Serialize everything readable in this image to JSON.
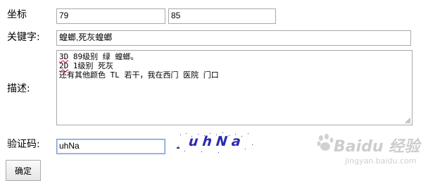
{
  "form": {
    "coords_label": "坐标",
    "coord_x_value": "79",
    "coord_y_value": "85",
    "keywords_label": "关键字:",
    "keywords_value": "蝗螂,死灰蝗螂",
    "description_label": "描述:",
    "description_lines": [
      {
        "prefix": "3D",
        "rest": " 89级别 绿 蝗螂。"
      },
      {
        "prefix": "2D",
        "rest": " 1级别 死灰"
      },
      {
        "prefix": "",
        "rest": "还有其他颜色 TL 若干，我在西门 医院 门口"
      }
    ],
    "captcha_label": "验证码:",
    "captcha_value": "uhNa",
    "captcha_image_text": "uhNa",
    "submit_label": "确定"
  },
  "watermark": {
    "brand": "Baidu 经验",
    "url": "jingyan.baidu.com"
  },
  "colors": {
    "captcha_text": "#2b2bb0",
    "focus_border": "#7a9cd3",
    "field_border": "#a9a9a9",
    "watermark": "#cdcdcd"
  }
}
